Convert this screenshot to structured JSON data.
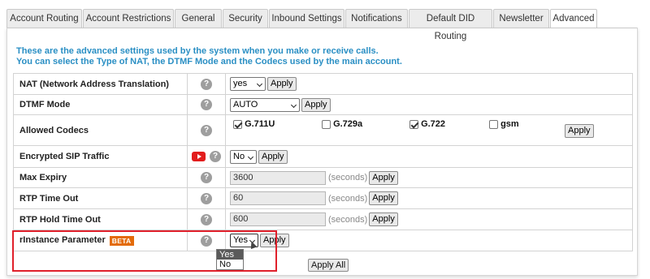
{
  "tabs": [
    {
      "label": "Account Routing"
    },
    {
      "label": "Account Restrictions"
    },
    {
      "label": "General"
    },
    {
      "label": "Security"
    },
    {
      "label": "Inbound Settings"
    },
    {
      "label": "Notifications"
    },
    {
      "label": "Default DID Routing"
    },
    {
      "label": "Newsletter"
    },
    {
      "label": "Advanced",
      "active": true
    }
  ],
  "intro": {
    "line1": "These are the advanced settings used by the system when you make or receive calls.",
    "line2": "You can select the Type of NAT, the DTMF Mode and the Codecs used by the main account."
  },
  "help_glyph": "?",
  "apply_label": "Apply",
  "seconds_label": "(seconds)",
  "rows": {
    "nat": {
      "label": "NAT (Network Address Translation)",
      "value": "yes"
    },
    "dtmf": {
      "label": "DTMF Mode",
      "value": "AUTO"
    },
    "codecs": {
      "label": "Allowed Codecs",
      "items": [
        {
          "name": "G.711U",
          "checked": true
        },
        {
          "name": "G.729a",
          "checked": false
        },
        {
          "name": "G.722",
          "checked": true
        },
        {
          "name": "gsm",
          "checked": false
        }
      ]
    },
    "sip": {
      "label": "Encrypted SIP Traffic",
      "value": "No"
    },
    "max_expiry": {
      "label": "Max Expiry",
      "value": "3600"
    },
    "rtp_timeout": {
      "label": "RTP Time Out",
      "value": "60"
    },
    "rtp_hold": {
      "label": "RTP Hold Time Out",
      "value": "600"
    },
    "rinstance": {
      "label": "rInstance Parameter",
      "badge": "BETA",
      "value": "Yes"
    }
  },
  "dropdown_options": [
    "Yes",
    "No"
  ],
  "apply_all_label": "Apply All",
  "colors": {
    "intro_text": "#2a8fc4",
    "beta_badge": "#e36b0a",
    "highlight_box": "#e0202b",
    "youtube_icon": "#e21d1d"
  }
}
